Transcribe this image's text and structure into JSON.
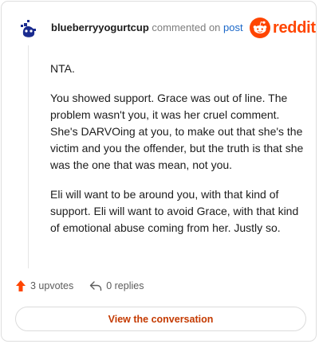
{
  "header": {
    "username": "blueberryyogurtcup",
    "action_text": "commented on",
    "post_link": "post"
  },
  "brand": {
    "logo_icon": "reddit-snoo-icon",
    "wordmark": "reddit",
    "color": "#ff4500"
  },
  "avatar": {
    "icon": "snoo-avatar-icon",
    "color": "#1a2b8f"
  },
  "comment": {
    "paragraphs": [
      "NTA.",
      "You showed support. Grace was out of line. The problem wasn't you, it was her cruel comment. She's DARVOing at you, to make out that she's the victim and you the offender, but the truth is that she was the one that was mean, not you.",
      "Eli will want to be around you, with that kind of support. Eli will want to avoid Grace, with that kind of emotional abuse coming from her. Justly so."
    ]
  },
  "actions": {
    "upvotes_label": "3 upvotes",
    "upvote_icon": "upvote-arrow-icon",
    "replies_label": "0 replies",
    "reply_icon": "reply-arrow-icon"
  },
  "cta": {
    "label": "View the conversation",
    "color": "#c43a00"
  }
}
